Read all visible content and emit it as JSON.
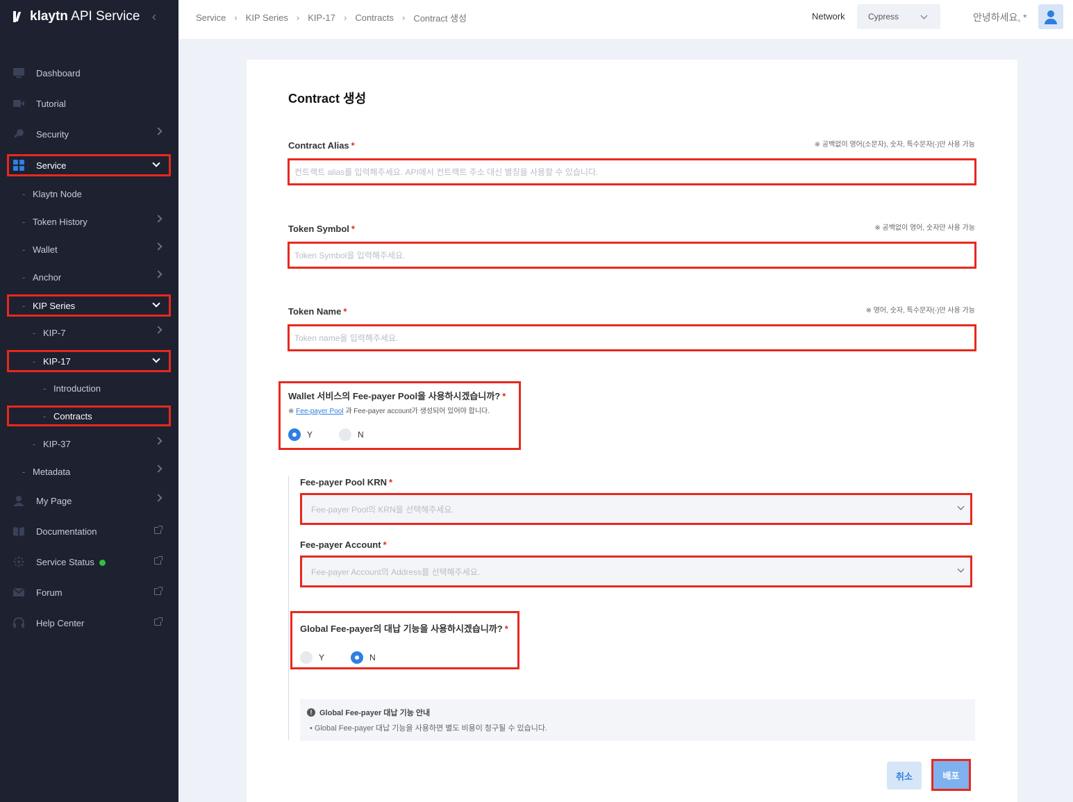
{
  "app": {
    "logo_bold": "klaytn",
    "logo_rest": " API Service"
  },
  "sidebar": {
    "dashboard": "Dashboard",
    "tutorial": "Tutorial",
    "security": "Security",
    "service": "Service",
    "klaytn_node": "Klaytn Node",
    "token_history": "Token History",
    "wallet": "Wallet",
    "anchor": "Anchor",
    "kip_series": "KIP Series",
    "kip7": "KIP-7",
    "kip17": "KIP-17",
    "introduction": "Introduction",
    "contracts": "Contracts",
    "kip37": "KIP-37",
    "metadata": "Metadata",
    "my_page": "My Page",
    "documentation": "Documentation",
    "service_status": "Service Status",
    "forum": "Forum",
    "help_center": "Help Center",
    "status_color": "#2fc13e"
  },
  "header": {
    "breadcrumb": [
      "Service",
      "KIP Series",
      "KIP-17",
      "Contracts",
      "Contract 생성"
    ],
    "network_label": "Network",
    "network_value": "Cypress",
    "greeting": "안녕하세요, *"
  },
  "form": {
    "title": "Contract 생성",
    "alias_label": "Contract Alias",
    "alias_hint": "※ 공백없이 영어(소문자), 숫자, 특수문자(-)만 사용 가능",
    "alias_placeholder": "컨트랙트 alias를 입력해주세요. API에서 컨트랙트 주소 대신 별칭을 사용할 수 있습니다.",
    "symbol_label": "Token Symbol",
    "symbol_hint": "※ 공백없이 영어, 숫자만 사용 가능",
    "symbol_placeholder": "Token Symbol을 입력해주세요.",
    "name_label": "Token Name",
    "name_hint": "※ 영어, 숫자, 특수문자(-)만 사용 가능",
    "name_placeholder": "Token name을 입력해주세요.",
    "fee_pool_question": "Wallet 서비스의 Fee-payer Pool을 사용하시겠습니까?",
    "fee_pool_note_prefix": "※ ",
    "fee_pool_note_link": "Fee-payer Pool",
    "fee_pool_note_suffix": " 과 Fee-payer account가 생성되어 있어야 합니다.",
    "yes": "Y",
    "no": "N",
    "krn_label": "Fee-payer Pool KRN",
    "krn_placeholder": "Fee-payer Pool의 KRN을 선택해주세요.",
    "account_label": "Fee-payer Account",
    "account_placeholder": "Fee-payer Account의 Address를 선택해주세요.",
    "global_question": "Global Fee-payer의 대납 기능을 사용하시겠습니까?",
    "info_title": "Global Fee-payer 대납 기능 안내",
    "info_text": "•  Global Fee-payer 대납 기능을 사용하면 별도 비용이 청구될 수 있습니다.",
    "cancel": "취소",
    "deploy": "배포",
    "required_mark": "*"
  },
  "colors": {
    "accent": "#2e7fe0",
    "highlight": "#e8281e",
    "sidebar_bg": "#1d2130"
  }
}
